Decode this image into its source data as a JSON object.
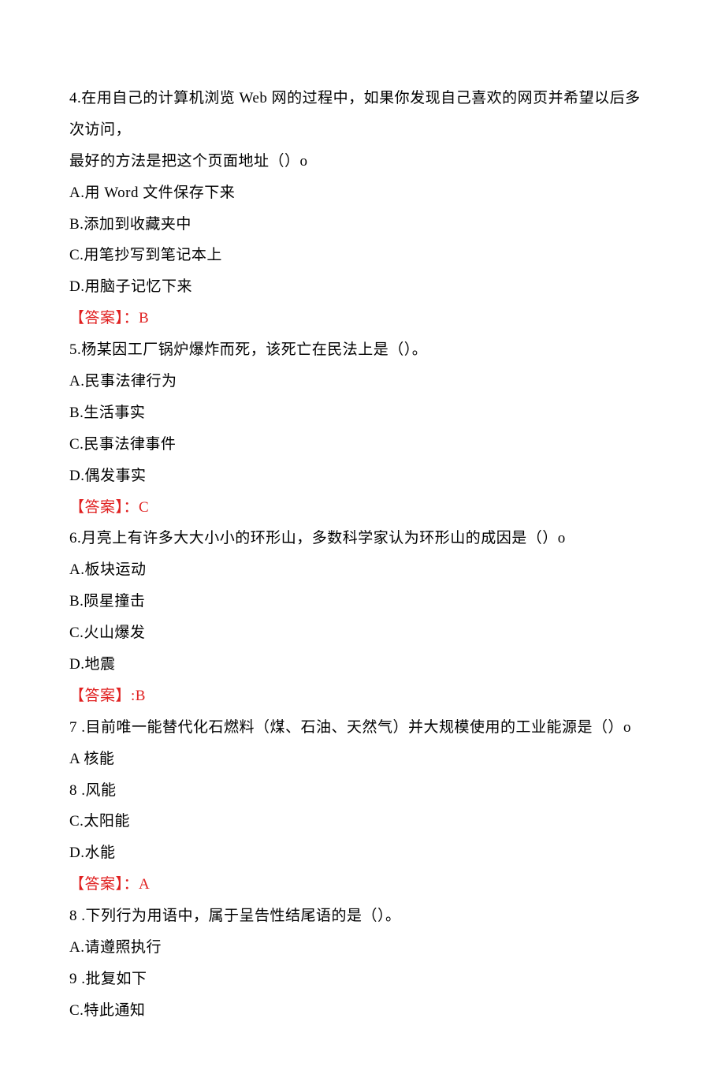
{
  "q4": {
    "text_line1": "4.在用自己的计算机浏览 Web 网的过程中，如果你发现自己喜欢的网页并希望以后多次访问，",
    "text_line2": "最好的方法是把这个页面地址（）o",
    "optA": "A.用 Word 文件保存下来",
    "optB": "B.添加到收藏夹中",
    "optC": "C.用笔抄写到笔记本上",
    "optD": "D.用脑子记忆下来",
    "answer": "【答案】：B"
  },
  "q5": {
    "text": "5.杨某因工厂锅炉爆炸而死，该死亡在民法上是（）。",
    "optA": "A.民事法律行为",
    "optB": "B.生活事实",
    "optC": "C.民事法律事件",
    "optD": "D.偶发事实",
    "answer": "【答案】：C"
  },
  "q6": {
    "text": "6.月亮上有许多大大小小的环形山，多数科学家认为环形山的成因是（）o",
    "optA": "A.板块运动",
    "optB": "B.陨星撞击",
    "optC": "C.火山爆发",
    "optD": "D.地震",
    "answer": "【答案】:B"
  },
  "q7": {
    "text": "7 .目前唯一能替代化石燃料（煤、石油、天然气）并大规模使用的工业能源是（）o",
    "optA": "A 核能",
    "optB": "8 .风能",
    "optC": "C.太阳能",
    "optD": "D.水能",
    "answer": "【答案】：A"
  },
  "q8": {
    "text": "8 .下列行为用语中，属于呈告性结尾语的是（）。",
    "optA": "A.请遵照执行",
    "optB": "9 .批复如下",
    "optC": "C.特此通知"
  }
}
